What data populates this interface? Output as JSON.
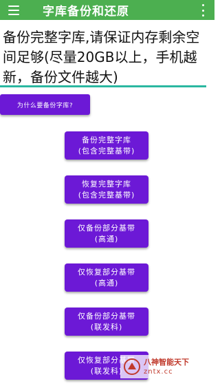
{
  "appbar": {
    "title": "字库备份和还原",
    "menu_icon": "hamburger-menu-icon",
    "more_icon": "more-vert-icon",
    "color": "#4caf50"
  },
  "intro": {
    "text": "备份完整字库,请保证内存剩余空间足够(尽量20GB以上，手机越新，备份文件越大)"
  },
  "why_button": {
    "label": "为什么要备份字库?"
  },
  "actions": [
    {
      "line1": "备份完整字库",
      "line2": "(包含完整基带)"
    },
    {
      "line1": "恢复完整字库",
      "line2": "(包含完整基带)"
    },
    {
      "line1": "仅备份部分基带",
      "line2": "(高通)"
    },
    {
      "line1": "仅恢复部分基带",
      "line2": "(高通)"
    },
    {
      "line1": "仅备份部分基带",
      "line2": "(联发科)"
    },
    {
      "line1": "仅恢复部分基带",
      "line2": "(联发科)"
    }
  ],
  "watermark": {
    "line1": "八神智能天下",
    "line2": "zntx.cc"
  },
  "colors": {
    "button": "#6c19d6",
    "divider": "#2bb7a0"
  }
}
